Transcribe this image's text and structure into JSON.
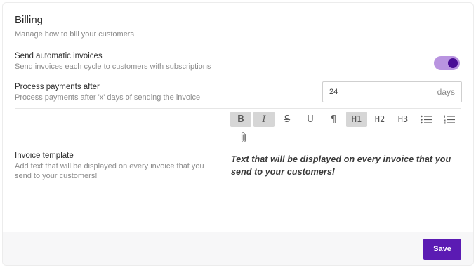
{
  "billing": {
    "title": "Billing",
    "description": "Manage how to bill your customers"
  },
  "auto_invoices": {
    "label": "Send automatic invoices",
    "description": "Send invoices each cycle to customers with subscriptions",
    "enabled": true
  },
  "process_payments": {
    "label": "Process payments after",
    "description": "Process payments after 'x' days of sending the invoice",
    "value": "24",
    "suffix": "days"
  },
  "toolbar": {
    "buttons": [
      {
        "name": "bold",
        "text": "B",
        "active": true
      },
      {
        "name": "italic",
        "text": "I",
        "active": true
      },
      {
        "name": "strikethrough",
        "text": "S",
        "active": false
      },
      {
        "name": "underline",
        "text": "U",
        "active": false
      },
      {
        "name": "paragraph",
        "text": "¶",
        "active": false
      },
      {
        "name": "heading-1",
        "text": "H1",
        "active": true
      },
      {
        "name": "heading-2",
        "text": "H2",
        "active": false
      },
      {
        "name": "heading-3",
        "text": "H3",
        "active": false
      },
      {
        "name": "bullet-list",
        "text": "",
        "active": false
      },
      {
        "name": "ordered-list",
        "text": "",
        "active": false
      },
      {
        "name": "attachment",
        "text": "",
        "active": false
      }
    ]
  },
  "invoice_template": {
    "label": "Invoice template",
    "description": "Add text that will be displayed on every invoice that you send to your customers!",
    "content": "Text that will be displayed on every invoice that you send to your customers!"
  },
  "footer": {
    "save_label": "Save"
  },
  "colors": {
    "accent": "#5b1bb3",
    "toggle_track": "#b994e0",
    "toggle_knob": "#4a0e96"
  }
}
